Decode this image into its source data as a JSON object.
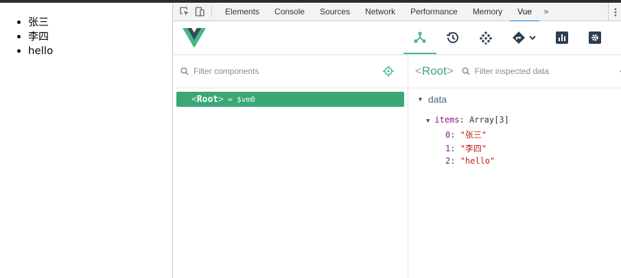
{
  "page": {
    "list": [
      "张三",
      "李四",
      "hello"
    ]
  },
  "devtools": {
    "tabs": [
      {
        "label": "Elements"
      },
      {
        "label": "Console"
      },
      {
        "label": "Sources"
      },
      {
        "label": "Network"
      },
      {
        "label": "Performance"
      },
      {
        "label": "Memory"
      },
      {
        "label": "Vue"
      }
    ],
    "active_tab": "Vue",
    "more_label": "»"
  },
  "vue": {
    "toolbar": {
      "icons": [
        "components-icon",
        "history-icon",
        "vuex-icon",
        "routing-icon",
        "performance-icon",
        "settings-icon"
      ]
    },
    "components": {
      "filter_placeholder": "Filter components",
      "tree": {
        "open": "<",
        "name": "Root",
        "close": ">",
        "vm": "= $vm0"
      }
    },
    "inspector": {
      "open": "<",
      "name": "Root",
      "close": ">",
      "filter_placeholder": "Filter inspected data",
      "section": "data",
      "items_key": "items",
      "items_type": "Array[3]",
      "entries": [
        {
          "index": "0",
          "value": "\"张三\""
        },
        {
          "index": "1",
          "value": "\"李四\""
        },
        {
          "index": "2",
          "value": "\"hello\""
        }
      ]
    }
  },
  "colors": {
    "vue_green": "#42b983",
    "selected_row": "#3ba776",
    "active_tab_underline": "#1a73e8"
  }
}
